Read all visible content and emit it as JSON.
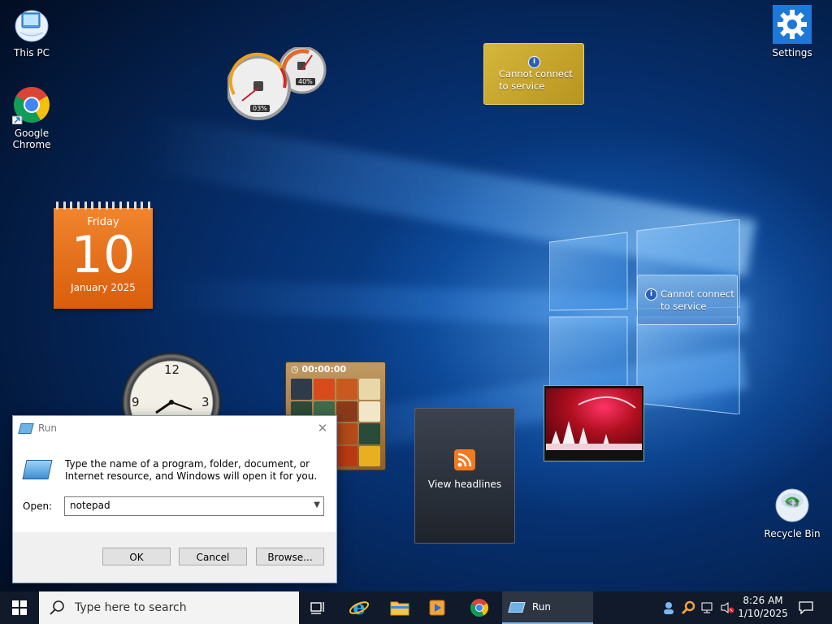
{
  "desktop": {
    "icons": [
      {
        "label": "This PC"
      },
      {
        "label": "Google Chrome"
      },
      {
        "label": "Settings"
      },
      {
        "label": "Recycle Bin"
      }
    ]
  },
  "gadgets": {
    "calendar": {
      "weekday": "Friday",
      "day": "10",
      "month_year": "January 2025"
    },
    "news_top": {
      "line1": "Cannot connect",
      "line2": "to service"
    },
    "news_right": {
      "line1": "Cannot connect",
      "line2": "to service"
    },
    "headlines": {
      "label": "View headlines"
    },
    "puzzle": {
      "timer": "00:00:00"
    },
    "meter": {
      "cpu": "03%",
      "memory": "40%"
    },
    "clock": {
      "n12": "12",
      "n3": "3",
      "n9": "9"
    }
  },
  "run_dialog": {
    "title": "Run",
    "description": "Type the name of a program, folder, document, or Internet resource, and Windows will open it for you.",
    "open_label": "Open:",
    "open_value": "notepad",
    "ok": "OK",
    "cancel": "Cancel",
    "browse": "Browse..."
  },
  "taskbar": {
    "search_placeholder": "Type here to search",
    "run_label": "Run",
    "time": "8:26 AM",
    "date": "1/10/2025"
  },
  "colors": {
    "calendar_orange": "#e8701a",
    "taskbar_bg": "#101a2a",
    "accent_blue": "#2b79d8"
  }
}
